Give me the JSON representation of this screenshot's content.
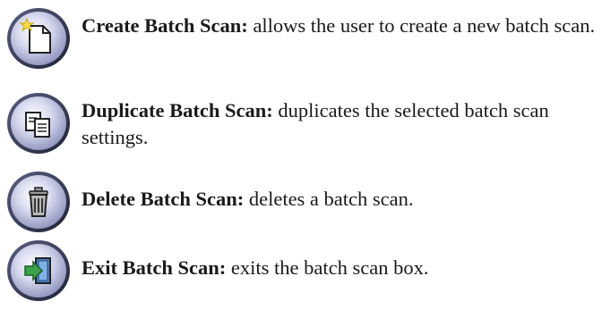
{
  "entries": [
    {
      "icon": "new-document-icon",
      "title": "Create Batch Scan:",
      "description": " allows the user to create a new batch scan."
    },
    {
      "icon": "duplicate-icon",
      "title": "Duplicate Batch Scan:",
      "description": " duplicates the selected batch scan settings."
    },
    {
      "icon": "trash-icon",
      "title": "Delete Batch Scan:",
      "description": " deletes a batch scan."
    },
    {
      "icon": "exit-icon",
      "title": "Exit Batch Scan:",
      "description": " exits the batch scan box."
    }
  ],
  "colors": {
    "button_face": "#c9cde8",
    "button_rim": "#3a3f5c",
    "exit_arrow": "#3aa34a",
    "exit_panel": "#4a7fc0"
  }
}
